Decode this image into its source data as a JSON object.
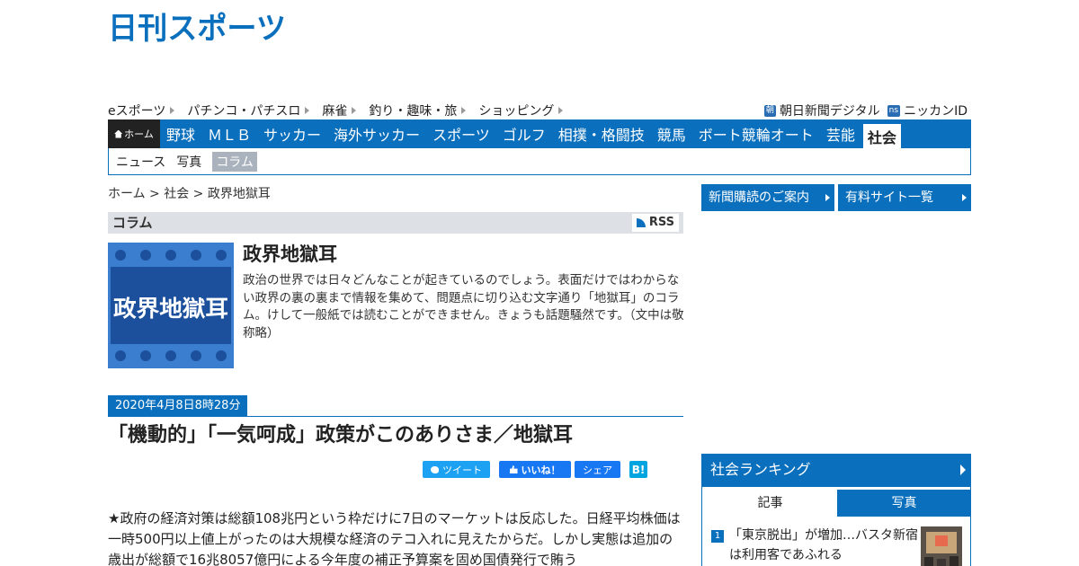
{
  "logo": {
    "text": "日刊スポーツ",
    "color": "#0a6fbd"
  },
  "util_nav": {
    "left": [
      "eスポーツ",
      "パチンコ・パチスロ",
      "麻雀",
      "釣り・趣味・旅",
      "ショッピング"
    ],
    "right": [
      {
        "badge": "朝",
        "label": "朝日新聞デジタル"
      },
      {
        "badge": "ns",
        "label": "ニッカンID"
      }
    ]
  },
  "global_nav": {
    "home": "ホーム",
    "items": [
      "野球",
      "ＭＬＢ",
      "サッカー",
      "海外サッカー",
      "スポーツ",
      "ゴルフ",
      "相撲・格闘技",
      "競馬",
      "ボート競輪オート",
      "芸能"
    ],
    "active": "社会"
  },
  "sub_nav": {
    "items": [
      "ニュース",
      "写真"
    ],
    "active": "コラム"
  },
  "breadcrumb": "ホーム > 社会 > 政界地獄耳",
  "column": {
    "section": "コラム",
    "rss": "RSS",
    "title": "政界地獄耳",
    "image_text": "政界地獄耳",
    "description": "政治の世界では日々どんなことが起きているのでしょう。表面だけではわからない政界の裏の裏まで情報を集めて、問題点に切り込む文字通り「地獄耳」のコラム。けして一般紙では読むことができません。きょうも話題騒然です。（文中は敬称略）"
  },
  "article": {
    "date": "2020年4月8日8時28分",
    "headline": "「機動的」「一気呵成」政策がこのありさま／地獄耳",
    "body": "★政府の経済対策は総額108兆円という枠だけに7日のマーケットは反応した。日経平均株価は一時500円以上値上がったのは大規模な経済のテコ入れに見えたからだ。しかし実態は追加の歳出が総額で16兆8057億円による今年度の補正予算案を固め国債発行で賄う"
  },
  "social": {
    "tweet": "ツイート",
    "like": "いいね！",
    "share": "シェア",
    "hatena": "B!"
  },
  "sidebar": {
    "buttons": [
      "新聞購読のご案内",
      "有料サイト一覧"
    ],
    "ranking": {
      "title": "社会ランキング",
      "tabs": [
        "記事",
        "写真"
      ],
      "items": [
        {
          "rank": "1",
          "text": "「東京脱出」が増加…バスタ新宿は利用客であふれる"
        }
      ]
    }
  }
}
